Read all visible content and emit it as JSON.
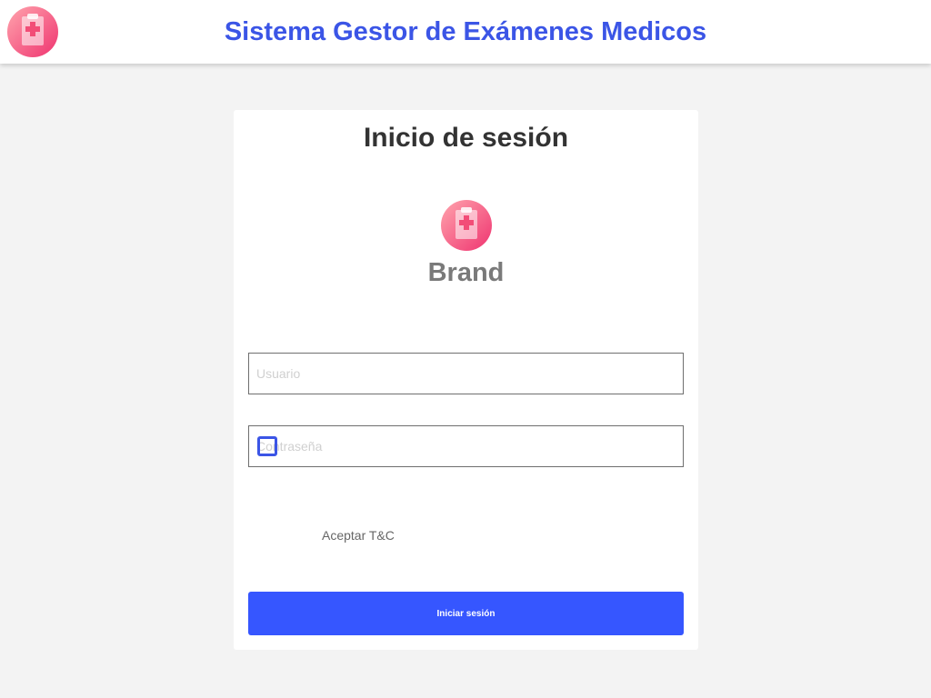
{
  "header": {
    "title": "Sistema Gestor de Exámenes Medicos",
    "logo_icon": "medical-clipboard-icon"
  },
  "login": {
    "title": "Inicio de sesión",
    "brand_icon": "medical-clipboard-icon",
    "brand_name": "Brand",
    "username_placeholder": "Usuario",
    "password_placeholder": "Contraseña",
    "terms_label": "Aceptar T&C",
    "submit_label": "Iniciar sesión"
  },
  "colors": {
    "accent": "#3b55e6",
    "button": "#3656ff",
    "logo_gradient_start": "#ff9ea8",
    "logo_gradient_end": "#f23d73",
    "background": "#f3f3f3"
  }
}
